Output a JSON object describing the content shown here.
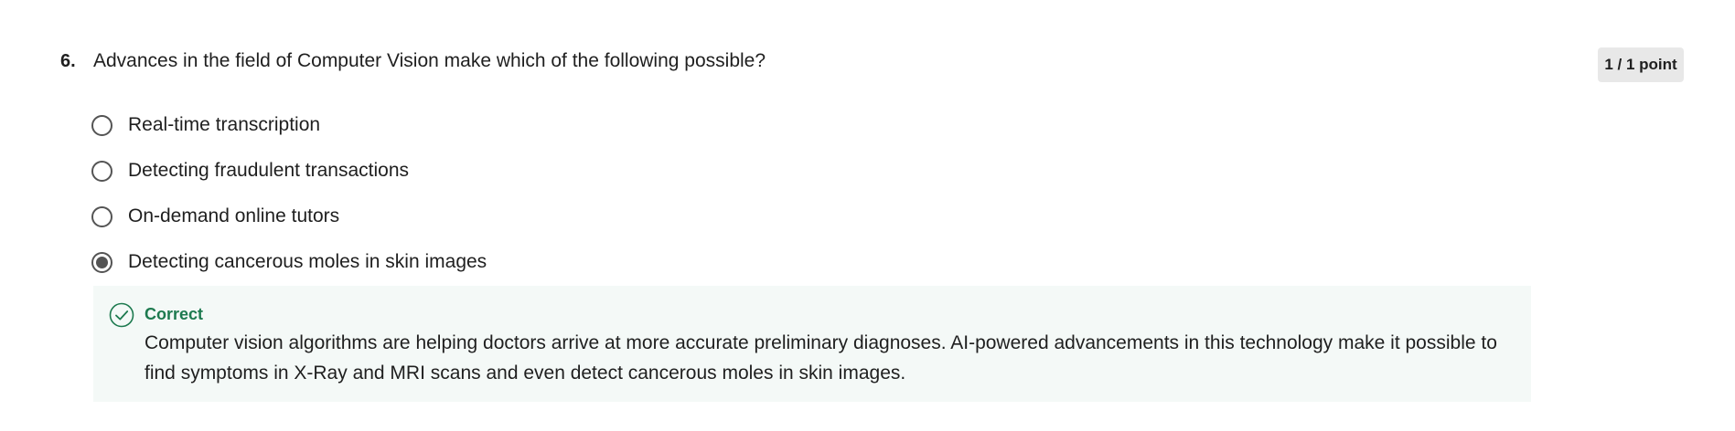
{
  "question": {
    "number": "6.",
    "text": "Advances in the field of Computer Vision make which of the following possible?",
    "points": "1 / 1 point"
  },
  "options": [
    {
      "label": "Real-time transcription",
      "selected": false
    },
    {
      "label": "Detecting fraudulent transactions",
      "selected": false
    },
    {
      "label": "On-demand online tutors",
      "selected": false
    },
    {
      "label": "Detecting cancerous moles in skin images",
      "selected": true
    }
  ],
  "feedback": {
    "status": "Correct",
    "icon": "check-circle-icon",
    "text": "Computer vision algorithms are helping doctors arrive at more accurate preliminary diagnoses. AI-powered advancements in this technology make it possible to find symptoms in X-Ray and MRI scans and even detect cancerous moles in skin images.",
    "status_color": "#1d7a4f",
    "background_color": "#f4f9f7"
  }
}
